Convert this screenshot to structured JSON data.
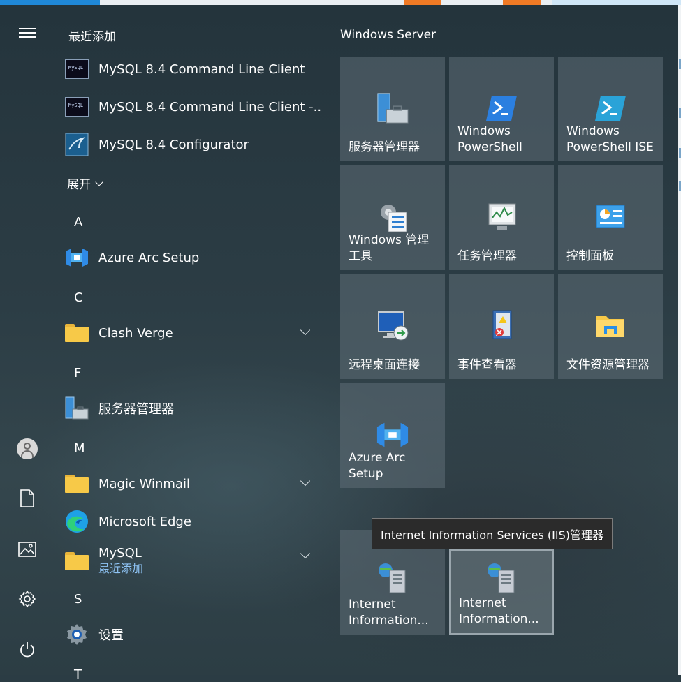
{
  "colors": {
    "accent": "#1f88d8",
    "tooltip_bg": "#2b2b2b",
    "link": "#8fc4f5"
  },
  "rail": {
    "icons": [
      "hamburger-icon",
      "user-avatar-icon",
      "documents-icon",
      "pictures-icon",
      "settings-icon",
      "power-icon"
    ]
  },
  "applist": {
    "recent_title": "最近添加",
    "recent": [
      {
        "label": "MySQL 8.4 Command Line Client",
        "icon": "mysql-terminal-icon"
      },
      {
        "label": "MySQL 8.4 Command Line Client -...",
        "icon": "mysql-terminal-icon"
      },
      {
        "label": "MySQL 8.4 Configurator",
        "icon": "mysql-configurator-icon"
      }
    ],
    "expand_label": "展开",
    "letters": {
      "a": "A",
      "c": "C",
      "f": "F",
      "m": "M",
      "s": "S",
      "t": "T"
    },
    "apps": {
      "azure": {
        "label": "Azure Arc Setup",
        "icon": "azure-arc-icon"
      },
      "clash": {
        "label": "Clash Verge",
        "icon": "folder-icon"
      },
      "server_mgr": {
        "label": "服务器管理器",
        "icon": "server-manager-icon"
      },
      "winmail": {
        "label": "Magic Winmail",
        "icon": "folder-icon"
      },
      "edge": {
        "label": "Microsoft Edge",
        "icon": "edge-icon"
      },
      "mysql": {
        "label": "MySQL",
        "sub": "最近添加",
        "icon": "folder-icon"
      },
      "settings": {
        "label": "设置",
        "icon": "gear-icon"
      }
    }
  },
  "tiles": {
    "group_title": "Windows Server",
    "items": [
      {
        "label": "服务器管理器",
        "icon": "server-manager-icon"
      },
      {
        "label": "Windows\nPowerShell",
        "icon": "powershell-icon"
      },
      {
        "label": "Windows\nPowerShell ISE",
        "icon": "powershell-ise-icon"
      },
      {
        "label": "Windows 管理\n工具",
        "icon": "admin-tools-icon"
      },
      {
        "label": "任务管理器",
        "icon": "task-manager-icon"
      },
      {
        "label": "控制面板",
        "icon": "control-panel-icon"
      },
      {
        "label": "远程桌面连接",
        "icon": "remote-desktop-icon"
      },
      {
        "label": "事件查看器",
        "icon": "event-viewer-icon"
      },
      {
        "label": "文件资源管理器",
        "icon": "file-explorer-icon"
      },
      {
        "label": "Azure Arc\nSetup",
        "icon": "azure-arc-icon"
      },
      {
        "label": "Internet\nInformation...",
        "icon": "iis-icon"
      },
      {
        "label": "Internet\nInformation...",
        "icon": "iis-icon"
      }
    ]
  },
  "tooltip": "Internet Information Services (IIS)管理器"
}
